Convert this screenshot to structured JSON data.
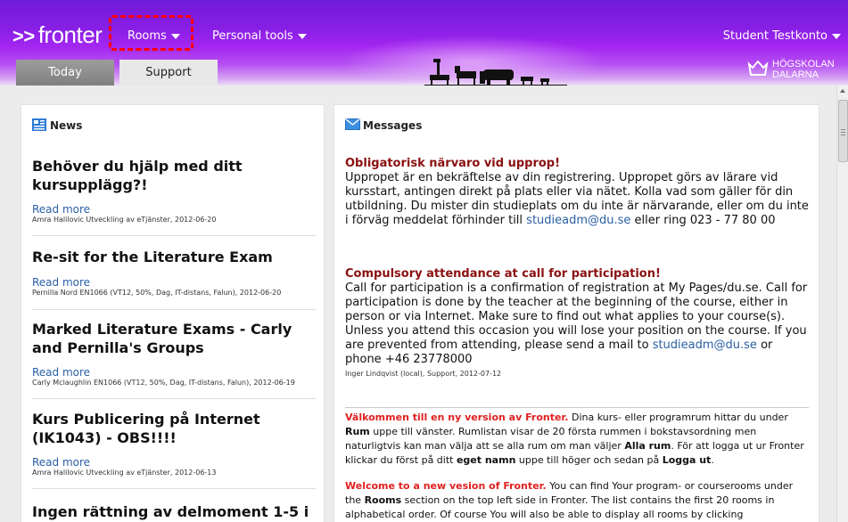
{
  "header": {
    "logo_text": "fronter",
    "logo_chevrons": ">>",
    "nav": {
      "rooms": "Rooms",
      "personal_tools": "Personal tools",
      "user": "Student Testkonto"
    },
    "tabs": {
      "today": "Today",
      "support": "Support"
    },
    "brand": {
      "line1": "HÖGSKOLAN",
      "line2": "DALARNA"
    }
  },
  "news": {
    "title": "News",
    "read_more": "Read more",
    "items": [
      {
        "title": "Behöver du hjälp med ditt kursupplägg?!",
        "meta": "Amra Halilovic Utveckling av eTjänster, 2012-06-20"
      },
      {
        "title": "Re-sit for the Literature Exam",
        "meta": "Pernilla Nord EN1066 (VT12, 50%, Dag, IT-distans, Falun), 2012-06-20"
      },
      {
        "title": "Marked Literature Exams - Carly and Pernilla's Groups",
        "meta": "Carly Mclaughlin EN1066 (VT12, 50%, Dag, IT-distans, Falun), 2012-06-19"
      },
      {
        "title": "Kurs Publicering på Internet (IK1043) - OBS!!!!",
        "meta": "Amra Halilovic Utveckling av eTjänster, 2012-06-13"
      },
      {
        "title": "Ingen rättning av delmoment 1-5 i"
      }
    ]
  },
  "messages": {
    "title": "Messages",
    "msg1": {
      "title": "Obligatorisk närvaro vid upprop!",
      "body": "Uppropet är en bekräftelse av din registrering. Uppropet görs av lärare vid kursstart, antingen direkt på plats eller via nätet. Kolla vad som gäller för din utbildning. Du mister din studieplats om du inte är närvarande, eller om du inte i förväg meddelat förhinder till",
      "link": "studieadm@du.se",
      "tail": " eller ring 023 - 77 80 00"
    },
    "msg2": {
      "title": "Compulsory attendance at call for participation!",
      "body": "Call for participation is a confirmation of registration at My Pages/du.se. Call for participation is done by the teacher at the beginning of the course, either in person or via Internet. Make sure to find out what applies to your course(s). Unless you attend this occasion you will lose your position on the course. If you are prevented from attending, please send a mail to",
      "link": "studieadm@du.se",
      "tail": " or phone +46 23778000",
      "meta": "Inger Lindqvist (local),  Support,  2012-07-12"
    },
    "msg3": {
      "lead": "Välkommen till en ny version av Fronter.",
      "p1": " Dina kurs- eller programrum hittar du under ",
      "b1": "Rum",
      "p2": " uppe till vänster. Rumlistan visar de 20 första rummen i bokstavsordning men naturligtvis kan man välja att se alla rum om man väljer ",
      "b2": "Alla rum",
      "p3": ". För att logga ut ur Fronter klickar du först på ditt ",
      "b3": "eget namn",
      "p4": " uppe till höger och sedan på ",
      "b4": "Logga ut",
      "p5": "."
    },
    "msg4": {
      "lead": "Welcome to a new vesion of Fronter.",
      "p1": " You can find Your program- or courserooms under the ",
      "b1": "Rooms",
      "p2": " section on the top left side in Fronter. The list contains the first 20 rooms in alphabetical order. Of course You will also be able to display all rooms by clicking"
    }
  },
  "colors": {
    "header_purple": "#8a1fe6",
    "message_title": "#8a1010",
    "link": "#2a5fa5",
    "highlight_red": "#e02020"
  }
}
